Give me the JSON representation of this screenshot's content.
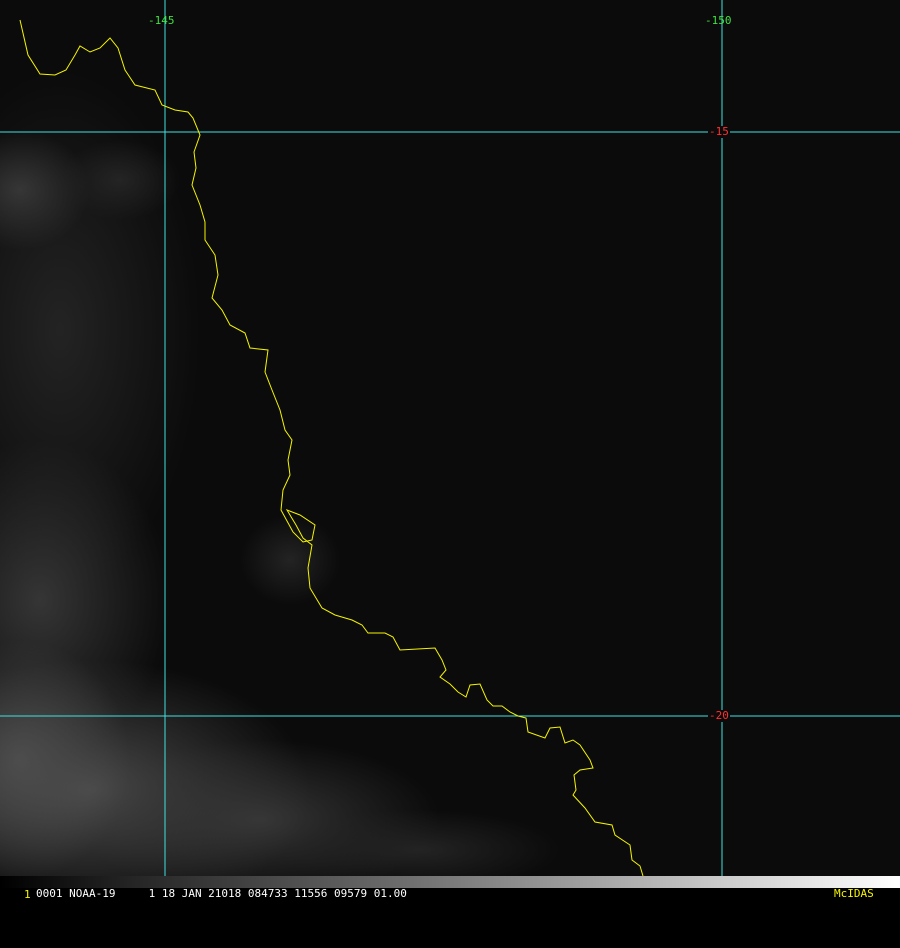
{
  "colors": {
    "grid": "#40e0e0",
    "coastline": "#f5f500",
    "lon_label": "#40e040",
    "lat_label": "#ff3030",
    "status_text": "#ffffff",
    "frame_number": "#f5f500",
    "brand": "#f5f500"
  },
  "map": {
    "longitude_labels": [
      "-145",
      "-150"
    ],
    "latitude_labels": [
      "-15",
      "-20"
    ]
  },
  "status": {
    "frame_number": "1",
    "info": "0001 NOAA-19     1 18 JAN 21018 084733 11556 09579 01.00",
    "brand": "McIDAS"
  }
}
